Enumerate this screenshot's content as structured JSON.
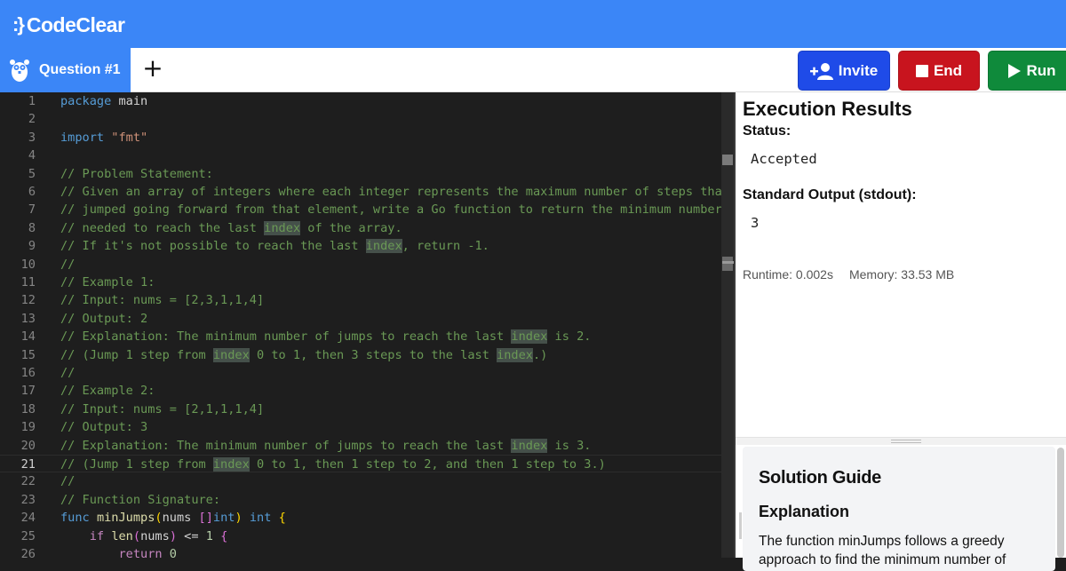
{
  "app": {
    "name": "CodeClear",
    "logo_mark": ":}"
  },
  "tabs": {
    "active_label": "Question #1",
    "add_label": "+"
  },
  "toolbar": {
    "invite_label": "Invite",
    "end_label": "End",
    "run_label": "Run"
  },
  "editor": {
    "current_line": 21,
    "lines": [
      {
        "n": "1",
        "tokens": [
          [
            "kw",
            "package"
          ],
          [
            "id",
            " main"
          ]
        ]
      },
      {
        "n": "2",
        "tokens": []
      },
      {
        "n": "3",
        "tokens": [
          [
            "kw",
            "import"
          ],
          [
            "id",
            " "
          ],
          [
            "str",
            "\"fmt\""
          ]
        ]
      },
      {
        "n": "4",
        "tokens": []
      },
      {
        "n": "5",
        "tokens": [
          [
            "com",
            "// Problem Statement:"
          ]
        ]
      },
      {
        "n": "6",
        "tokens": [
          [
            "com",
            "// Given an array of integers where each integer represents the maximum number of steps that"
          ]
        ]
      },
      {
        "n": "7",
        "tokens": [
          [
            "com",
            "// jumped going forward from that element, write a Go function to return the minimum number o"
          ]
        ]
      },
      {
        "n": "8",
        "tokens": [
          [
            "com",
            "// needed to reach the last "
          ],
          [
            "hl",
            "index"
          ],
          [
            "com",
            " of the array."
          ]
        ]
      },
      {
        "n": "9",
        "tokens": [
          [
            "com",
            "// If it's not possible to reach the last "
          ],
          [
            "hl",
            "index"
          ],
          [
            "com",
            ", return -1."
          ]
        ]
      },
      {
        "n": "10",
        "tokens": [
          [
            "com",
            "//"
          ]
        ]
      },
      {
        "n": "11",
        "tokens": [
          [
            "com",
            "// Example 1:"
          ]
        ]
      },
      {
        "n": "12",
        "tokens": [
          [
            "com",
            "// Input: nums = [2,3,1,1,4]"
          ]
        ]
      },
      {
        "n": "13",
        "tokens": [
          [
            "com",
            "// Output: 2"
          ]
        ]
      },
      {
        "n": "14",
        "tokens": [
          [
            "com",
            "// Explanation: The minimum number of jumps to reach the last "
          ],
          [
            "hl",
            "index"
          ],
          [
            "com",
            " is 2."
          ]
        ]
      },
      {
        "n": "15",
        "tokens": [
          [
            "com",
            "// (Jump 1 step from "
          ],
          [
            "hl",
            "index"
          ],
          [
            "com",
            " 0 to 1, then 3 steps to the last "
          ],
          [
            "hl",
            "index"
          ],
          [
            "com",
            ".)"
          ]
        ]
      },
      {
        "n": "16",
        "tokens": [
          [
            "com",
            "//"
          ]
        ]
      },
      {
        "n": "17",
        "tokens": [
          [
            "com",
            "// Example 2:"
          ]
        ]
      },
      {
        "n": "18",
        "tokens": [
          [
            "com",
            "// Input: nums = [2,1,1,1,4]"
          ]
        ]
      },
      {
        "n": "19",
        "tokens": [
          [
            "com",
            "// Output: 3"
          ]
        ]
      },
      {
        "n": "20",
        "tokens": [
          [
            "com",
            "// Explanation: The minimum number of jumps to reach the last "
          ],
          [
            "hl",
            "index"
          ],
          [
            "com",
            " is 3."
          ]
        ]
      },
      {
        "n": "21",
        "tokens": [
          [
            "com",
            "// (Jump 1 step from "
          ],
          [
            "hl",
            "index"
          ],
          [
            "com",
            " 0 to 1, then 1 step to 2, and then 1 step to 3.)"
          ]
        ]
      },
      {
        "n": "22",
        "tokens": [
          [
            "com",
            "//"
          ]
        ]
      },
      {
        "n": "23",
        "tokens": [
          [
            "com",
            "// Function Signature:"
          ]
        ]
      },
      {
        "n": "24",
        "tokens": [
          [
            "kw",
            "func"
          ],
          [
            "id",
            " "
          ],
          [
            "fn",
            "minJumps"
          ],
          [
            "br1",
            "("
          ],
          [
            "id",
            "nums "
          ],
          [
            "br2",
            "[]"
          ],
          [
            "kw",
            "int"
          ],
          [
            "br1",
            ")"
          ],
          [
            "id",
            " "
          ],
          [
            "kw",
            "int"
          ],
          [
            "id",
            " "
          ],
          [
            "br1",
            "{"
          ]
        ]
      },
      {
        "n": "25",
        "tokens": [
          [
            "id",
            "    "
          ],
          [
            "ctl",
            "if"
          ],
          [
            "id",
            " "
          ],
          [
            "fn",
            "len"
          ],
          [
            "br2",
            "("
          ],
          [
            "id",
            "nums"
          ],
          [
            "br2",
            ")"
          ],
          [
            "id",
            " <= "
          ],
          [
            "num",
            "1"
          ],
          [
            "id",
            " "
          ],
          [
            "br2",
            "{"
          ]
        ]
      },
      {
        "n": "26",
        "tokens": [
          [
            "id",
            "        "
          ],
          [
            "ctl",
            "return"
          ],
          [
            "id",
            " "
          ],
          [
            "num",
            "0"
          ]
        ]
      }
    ]
  },
  "results": {
    "title": "Execution Results",
    "status_label": "Status:",
    "status_value": "Accepted",
    "stdout_label": "Standard Output (stdout):",
    "stdout_value": "3",
    "runtime": "Runtime: 0.002s",
    "memory": "Memory: 33.53 MB"
  },
  "guide": {
    "title": "Solution Guide",
    "subtitle": "Explanation",
    "text": "The function minJumps follows a greedy approach to find the minimum number of"
  },
  "colors": {
    "brand": "#3b86f7",
    "invite": "#1f4be8",
    "end": "#c8141e",
    "run": "#0f8a3b"
  }
}
